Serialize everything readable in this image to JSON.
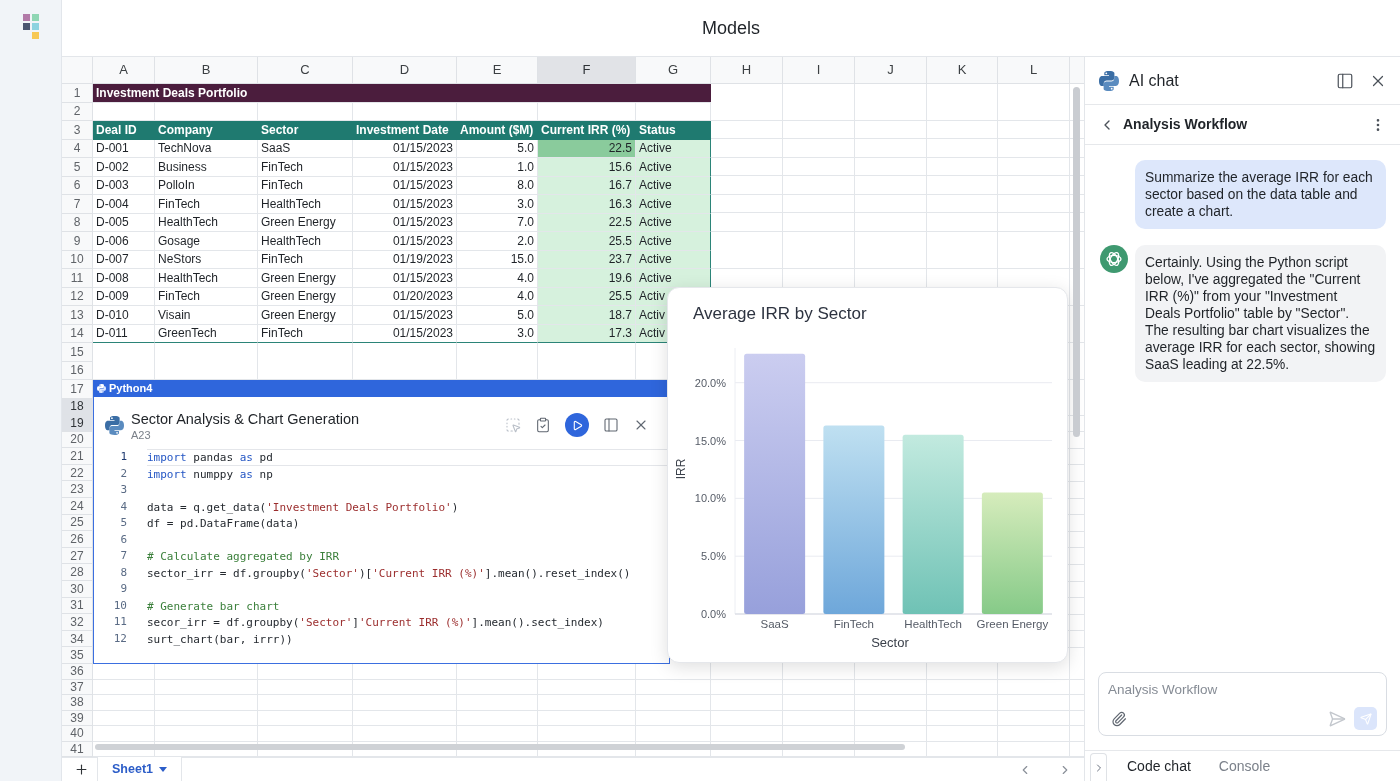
{
  "app": {
    "title": "Models"
  },
  "sheet": {
    "columns": [
      {
        "label": "A",
        "selected": false
      },
      {
        "label": "B",
        "selected": false
      },
      {
        "label": "C",
        "selected": false
      },
      {
        "label": "D",
        "selected": false
      },
      {
        "label": "E",
        "selected": false
      },
      {
        "label": "F",
        "selected": true
      },
      {
        "label": "G",
        "selected": false
      },
      {
        "label": "H",
        "selected": false
      },
      {
        "label": "I",
        "selected": false
      },
      {
        "label": "J",
        "selected": false
      },
      {
        "label": "K",
        "selected": false
      },
      {
        "label": "L",
        "selected": false
      }
    ],
    "row_headers": [
      {
        "label": "1",
        "selected": false
      },
      {
        "label": "2",
        "selected": false
      },
      {
        "label": "3",
        "selected": false
      },
      {
        "label": "4",
        "selected": false
      },
      {
        "label": "5",
        "selected": false
      },
      {
        "label": "6",
        "selected": false
      },
      {
        "label": "7",
        "selected": false
      },
      {
        "label": "8",
        "selected": false
      },
      {
        "label": "9",
        "selected": false
      },
      {
        "label": "10",
        "selected": false
      },
      {
        "label": "11",
        "selected": false
      },
      {
        "label": "12",
        "selected": false
      },
      {
        "label": "13",
        "selected": false
      },
      {
        "label": "14",
        "selected": false
      },
      {
        "label": "15",
        "selected": false
      },
      {
        "label": "16",
        "selected": false
      },
      {
        "label": "17",
        "selected": false
      },
      {
        "label": "18",
        "selected": true
      },
      {
        "label": "19",
        "selected": true
      },
      {
        "label": "20",
        "selected": false
      },
      {
        "label": "21",
        "selected": false
      },
      {
        "label": "22",
        "selected": false
      },
      {
        "label": "23",
        "selected": false
      },
      {
        "label": "24",
        "selected": false
      },
      {
        "label": "25",
        "selected": false
      },
      {
        "label": "26",
        "selected": false
      },
      {
        "label": "27",
        "selected": false
      },
      {
        "label": "28",
        "selected": false
      },
      {
        "label": "30",
        "selected": false
      },
      {
        "label": "31",
        "selected": false
      },
      {
        "label": "32",
        "selected": false
      },
      {
        "label": "34",
        "selected": false
      },
      {
        "label": "35",
        "selected": false
      },
      {
        "label": "36",
        "selected": false
      },
      {
        "label": "37",
        "selected": false
      },
      {
        "label": "38",
        "selected": false
      },
      {
        "label": "39",
        "selected": false
      },
      {
        "label": "40",
        "selected": false
      },
      {
        "label": "41",
        "selected": false
      }
    ],
    "title_cell": "Investment Deals Portfolio",
    "table": {
      "columns": [
        "Deal ID",
        "Company",
        "Sector",
        "Investment Date",
        "Amount ($M)",
        "Current IRR (%)",
        "Status"
      ],
      "rows": [
        {
          "cells": [
            "D-001",
            "TechNova",
            "SaaS",
            "01/15/2023",
            "5.0",
            "22.5",
            "Active"
          ],
          "highlighted": true
        },
        {
          "cells": [
            "D-002",
            "Business",
            "FinTech",
            "01/15/2023",
            "1.0",
            "15.6",
            "Active"
          ],
          "highlighted": false
        },
        {
          "cells": [
            "D-003",
            "PolloIn",
            "FinTech",
            "01/15/2023",
            "8.0",
            "16.7",
            "Active"
          ],
          "highlighted": false
        },
        {
          "cells": [
            "D-004",
            "FinTech",
            "HealthTech",
            "01/15/2023",
            "3.0",
            "16.3",
            "Active"
          ],
          "highlighted": false
        },
        {
          "cells": [
            "D-005",
            "HealthTech",
            "Green Energy",
            "01/15/2023",
            "7.0",
            "22.5",
            "Active"
          ],
          "highlighted": false
        },
        {
          "cells": [
            "D-006",
            "Gosage",
            "HealthTech",
            "01/15/2023",
            "2.0",
            "25.5",
            "Active"
          ],
          "highlighted": false
        },
        {
          "cells": [
            "D-007",
            "NeStors",
            "FinTech",
            "01/19/2023",
            "15.0",
            "23.7",
            "Active"
          ],
          "highlighted": false
        },
        {
          "cells": [
            "D-008",
            "HealthTech",
            "Green Energy",
            "01/15/2023",
            "4.0",
            "19.6",
            "Active"
          ],
          "highlighted": false
        },
        {
          "cells": [
            "D-009",
            "FinTech",
            "Green Energy",
            "01/20/2023",
            "4.0",
            "25.5",
            "Activ"
          ],
          "highlighted": false
        },
        {
          "cells": [
            "D-010",
            "Visain",
            "Green Energy",
            "01/15/2023",
            "5.0",
            "18.7",
            "Activ"
          ],
          "highlighted": false
        },
        {
          "cells": [
            "D-011",
            "GreenTech",
            "FinTech",
            "01/15/2023",
            "3.0",
            "17.3",
            "Activ"
          ],
          "highlighted": false
        }
      ]
    },
    "tabs": [
      {
        "label": "Sheet1",
        "selected": true
      }
    ]
  },
  "code_cell": {
    "tab": "Python4",
    "title": "Sector Analysis & Chart Generation",
    "cell_ref": "A23",
    "lines": [
      {
        "number": "1",
        "current": true,
        "tokens": [
          {
            "kind": "keyword",
            "text": "import"
          },
          {
            "kind": "plain",
            "text": " pandas "
          },
          {
            "kind": "keyword",
            "text": "as"
          },
          {
            "kind": "plain",
            "text": " pd"
          }
        ]
      },
      {
        "number": "2",
        "current": false,
        "tokens": [
          {
            "kind": "keyword",
            "text": "import"
          },
          {
            "kind": "plain",
            "text": " numppy "
          },
          {
            "kind": "keyword",
            "text": "as"
          },
          {
            "kind": "plain",
            "text": " np"
          }
        ]
      },
      {
        "number": "3",
        "current": false
      },
      {
        "number": "4",
        "current": false,
        "tokens": [
          {
            "kind": "plain",
            "text": "data = q.get_data("
          },
          {
            "kind": "string",
            "text": "'Investment Deals Portfolio'"
          },
          {
            "kind": "plain",
            "text": ")"
          }
        ]
      },
      {
        "number": "5",
        "current": false,
        "tokens": [
          {
            "kind": "plain",
            "text": "df = pd.DataFrame(data)"
          }
        ]
      },
      {
        "number": "6",
        "current": false
      },
      {
        "number": "7",
        "current": false,
        "tokens": [
          {
            "kind": "comment",
            "text": "# Calculate aggregated by IRR"
          }
        ]
      },
      {
        "number": "8",
        "current": false,
        "tokens": [
          {
            "kind": "plain",
            "text": "sector_irr = df.groupby("
          },
          {
            "kind": "string",
            "text": "'Sector'"
          },
          {
            "kind": "plain",
            "text": ")["
          },
          {
            "kind": "string",
            "text": "'Current IRR (%)'"
          },
          {
            "kind": "plain",
            "text": "].mean().reset_index()"
          }
        ]
      },
      {
        "number": "9",
        "current": false
      },
      {
        "number": "10",
        "current": false,
        "tokens": [
          {
            "kind": "comment",
            "text": "# Generate bar chart"
          }
        ]
      },
      {
        "number": "11",
        "current": false,
        "tokens": [
          {
            "kind": "plain",
            "text": "secor_irr = df.groupby("
          },
          {
            "kind": "string",
            "text": "'Sector'"
          },
          {
            "kind": "plain",
            "text": "]"
          },
          {
            "kind": "string",
            "text": "'Current IRR (%)'"
          },
          {
            "kind": "plain",
            "text": "].mean().sect_index)"
          }
        ]
      },
      {
        "number": "12",
        "current": false,
        "tokens": [
          {
            "kind": "plain",
            "text": "surt_chart(bar, irrr))"
          }
        ]
      }
    ]
  },
  "chart": {
    "chart_data": {
      "type": "bar",
      "title": "Average IRR by Sector",
      "xlabel": "Sector",
      "ylabel": "IRR",
      "categories": [
        "SaaS",
        "FinTech",
        "HealthTech",
        "Green Energy"
      ],
      "values": [
        22.5,
        16.3,
        15.5,
        10.5
      ],
      "grid": true,
      "ylim": [
        0,
        23
      ],
      "yticks": [
        {
          "value": 0,
          "label": "0.0%"
        },
        {
          "value": 5,
          "label": "5.0%"
        },
        {
          "value": 10,
          "label": "10.0%"
        },
        {
          "value": 15,
          "label": "15.0%"
        },
        {
          "value": 20,
          "label": "20.0%"
        }
      ]
    }
  },
  "chat": {
    "title": "AI chat",
    "thread": "Analysis Workflow",
    "messages": [
      {
        "kind": "user",
        "text": "Summarize the average IRR for each sector based on the data table and create a chart."
      },
      {
        "kind": "assistant",
        "text": "Certainly. Using the Python script below, I've aggregated the \"Current IRR (%)\" from your \"Investment Deals Portfolio\" table by \"Sector\". The resulting bar chart visualizes the average IRR for each sector, showing SaaS leading at 22.5%."
      }
    ],
    "input": {
      "placeholder": "Analysis Workflow"
    },
    "tabs": [
      {
        "label": "Code chat",
        "selected": true
      },
      {
        "label": "Console",
        "selected": false
      }
    ]
  }
}
